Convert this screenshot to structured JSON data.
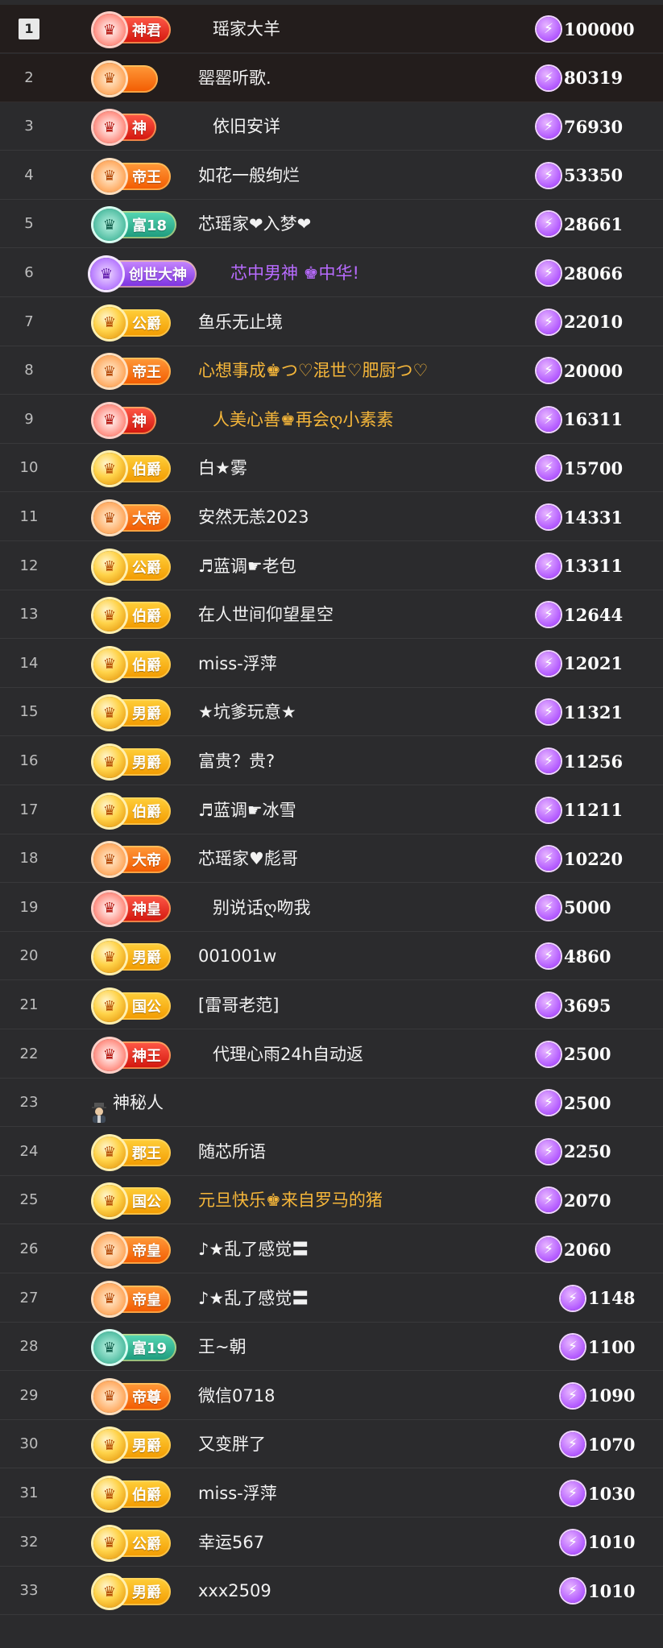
{
  "leaderboard": {
    "rows": [
      {
        "rank": "1",
        "badge": "神君",
        "tier": "red",
        "name": "瑶家大羊",
        "score": "100000"
      },
      {
        "rank": "2",
        "badge": "",
        "tier": "orange",
        "name": "罂罂听歌.",
        "score": "80319"
      },
      {
        "rank": "3",
        "badge": "神",
        "tier": "red",
        "name": "依旧安详",
        "score": "76930"
      },
      {
        "rank": "4",
        "badge": "帝王",
        "tier": "orange",
        "name": "如花一般绚烂",
        "score": "53350"
      },
      {
        "rank": "5",
        "badge": "富18",
        "tier": "green",
        "name": "芯瑶家❤入梦❤",
        "score": "28661"
      },
      {
        "rank": "6",
        "badge": "创世大神",
        "tier": "purple",
        "name": "芯中男神 ♚中华!",
        "score": "28066"
      },
      {
        "rank": "7",
        "badge": "公爵",
        "tier": "gold",
        "name": "鱼乐无止境",
        "score": "22010"
      },
      {
        "rank": "8",
        "badge": "帝王",
        "tier": "orange",
        "name": "心想事成♚つ♡混世♡肥厨つ♡",
        "score": "20000"
      },
      {
        "rank": "9",
        "badge": "神",
        "tier": "red",
        "name": "人美心善♚再会ღ小素素",
        "score": "16311"
      },
      {
        "rank": "10",
        "badge": "伯爵",
        "tier": "gold",
        "name": "白★雾",
        "score": "15700"
      },
      {
        "rank": "11",
        "badge": "大帝",
        "tier": "orange",
        "name": "安然无恙2023",
        "score": "14331"
      },
      {
        "rank": "12",
        "badge": "公爵",
        "tier": "gold",
        "name": "♬蓝调☛老包",
        "score": "13311"
      },
      {
        "rank": "13",
        "badge": "伯爵",
        "tier": "gold",
        "name": "在人世间仰望星空",
        "score": "12644"
      },
      {
        "rank": "14",
        "badge": "伯爵",
        "tier": "gold",
        "name": "miss-浮萍",
        "score": "12021"
      },
      {
        "rank": "15",
        "badge": "男爵",
        "tier": "gold",
        "name": "★坑爹玩意★",
        "score": "11321"
      },
      {
        "rank": "16",
        "badge": "男爵",
        "tier": "gold",
        "name": "富贵？贵?",
        "score": "11256"
      },
      {
        "rank": "17",
        "badge": "伯爵",
        "tier": "gold",
        "name": "♬蓝调☛冰雪",
        "score": "11211"
      },
      {
        "rank": "18",
        "badge": "大帝",
        "tier": "orange",
        "name": "芯瑶家♥彪哥",
        "score": "10220"
      },
      {
        "rank": "19",
        "badge": "神皇",
        "tier": "red",
        "name": "别说话ღ吻我",
        "score": "5000"
      },
      {
        "rank": "20",
        "badge": "男爵",
        "tier": "gold",
        "name": "001001w",
        "score": "4860"
      },
      {
        "rank": "21",
        "badge": "国公",
        "tier": "gold",
        "name": "[雷哥老范]",
        "score": "3695"
      },
      {
        "rank": "22",
        "badge": "神王",
        "tier": "red",
        "name": "代理心雨24h自动返",
        "score": "2500"
      },
      {
        "rank": "23",
        "badge": "",
        "tier": "anon",
        "name": "神秘人",
        "score": "2500"
      },
      {
        "rank": "24",
        "badge": "郡王",
        "tier": "gold",
        "name": "随芯所语",
        "score": "2250"
      },
      {
        "rank": "25",
        "badge": "国公",
        "tier": "gold",
        "name": "元旦快乐♚来自罗马的猪",
        "score": "2070"
      },
      {
        "rank": "26",
        "badge": "帝皇",
        "tier": "orange",
        "name": "♪★乱了感觉〓",
        "score": "2060"
      },
      {
        "rank": "27",
        "badge": "帝皇",
        "tier": "orange",
        "name": "♪★乱了感觉〓",
        "score": "1148"
      },
      {
        "rank": "28",
        "badge": "富19",
        "tier": "green",
        "name": "王~朝",
        "score": "1100"
      },
      {
        "rank": "29",
        "badge": "帝尊",
        "tier": "orange",
        "name": "微信0718",
        "score": "1090"
      },
      {
        "rank": "30",
        "badge": "男爵",
        "tier": "gold",
        "name": "又变胖了",
        "score": "1070"
      },
      {
        "rank": "31",
        "badge": "伯爵",
        "tier": "gold",
        "name": "miss-浮萍",
        "score": "1030"
      },
      {
        "rank": "32",
        "badge": "公爵",
        "tier": "gold",
        "name": "幸运567",
        "score": "1010"
      },
      {
        "rank": "33",
        "badge": "男爵",
        "tier": "gold",
        "name": "xxx2509",
        "score": "1010"
      }
    ]
  },
  "icons": {
    "currency": "lightning-coin-icon",
    "rank_badge": "noble-rank-badge-icon",
    "anonymous": "mystery-person-icon"
  },
  "colors": {
    "background": "#2b2b2d",
    "text": "#f2f2f2",
    "coin": "#9b30ff",
    "highlight_gold": "#f5b63a",
    "highlight_purple": "#b86bff"
  }
}
